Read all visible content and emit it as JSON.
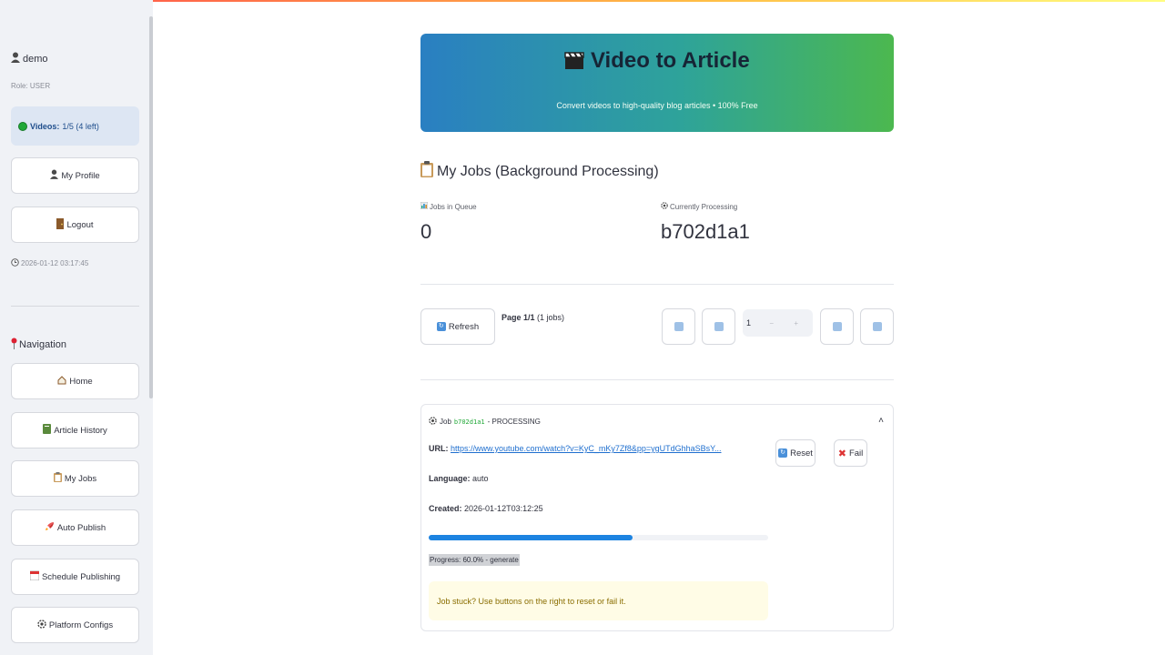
{
  "sidebar": {
    "username": "demo",
    "role": "Role: USER",
    "quota_label": "Videos:",
    "quota_value": "1/5 (4 left)",
    "profile_label": "My Profile",
    "logout_label": "Logout",
    "timestamp": "2026-01-12 03:17:45",
    "nav_title": "Navigation",
    "nav_items": [
      {
        "label": "Home",
        "icon": "house-icon"
      },
      {
        "label": "Article History",
        "icon": "book-icon"
      },
      {
        "label": "My Jobs",
        "icon": "clipboard-icon"
      },
      {
        "label": "Auto Publish",
        "icon": "rocket-icon"
      },
      {
        "label": "Schedule Publishing",
        "icon": "calendar-icon"
      },
      {
        "label": "Platform Configs",
        "icon": "gear-icon"
      }
    ]
  },
  "banner": {
    "title": "Video to Article",
    "subtitle": "Convert videos to high-quality blog articles • 100% Free"
  },
  "jobs": {
    "title": "My Jobs (Background Processing)",
    "queue_label": "Jobs in Queue",
    "queue_value": "0",
    "processing_label": "Currently Processing",
    "processing_value": "b702d1a1",
    "refresh_label": "Refresh",
    "page_label": "Page 1/1",
    "page_count": "(1 jobs)",
    "page_input": "1"
  },
  "job": {
    "prefix": "Job",
    "id": "b702d1a1",
    "status": "- PROCESSING",
    "url_label": "URL:",
    "url": "https://www.youtube.com/watch?v=KyC_mKy7Zf8&pp=ygUTdGhhaSBsY...",
    "language_label": "Language:",
    "language": "auto",
    "created_label": "Created:",
    "created": "2026-01-12T03:12:25",
    "progress": 0.6,
    "progress_text": "Progress: 60.0% - generate",
    "warning": "Job stuck? Use buttons on the right to reset or fail it.",
    "reset_label": "Reset",
    "fail_label": "Fail"
  }
}
